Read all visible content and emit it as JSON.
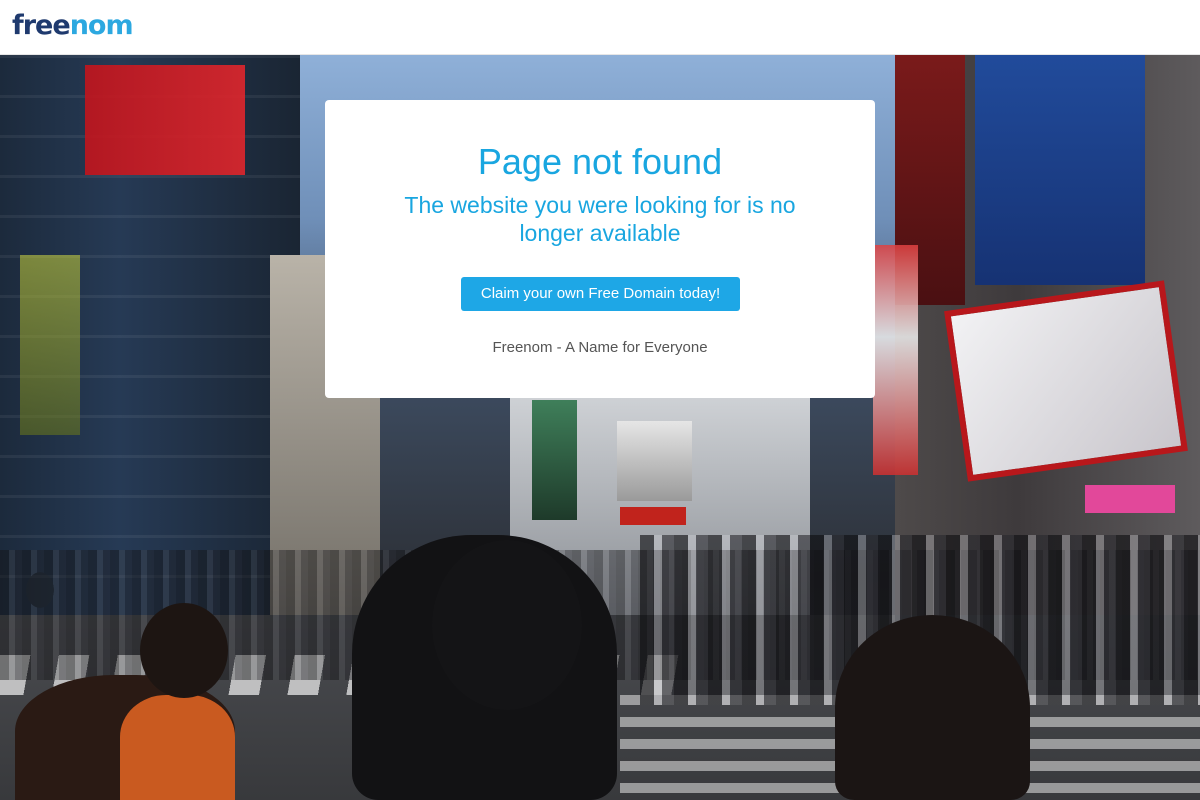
{
  "header": {
    "logo_part1": "free",
    "logo_part2": "nom"
  },
  "background": {
    "icon": "tokyo-street-photo"
  },
  "card": {
    "title": "Page not found",
    "subtitle": "The website you were looking for is no longer available",
    "button_label": "Claim your own Free Domain today!",
    "tagline": "Freenom - A Name for Everyone"
  },
  "colors": {
    "accent": "#19a6e0",
    "button": "#1ea7e6",
    "logo_dark": "#1f3a6e",
    "logo_light": "#2ca8e0",
    "tagline": "#555555"
  }
}
